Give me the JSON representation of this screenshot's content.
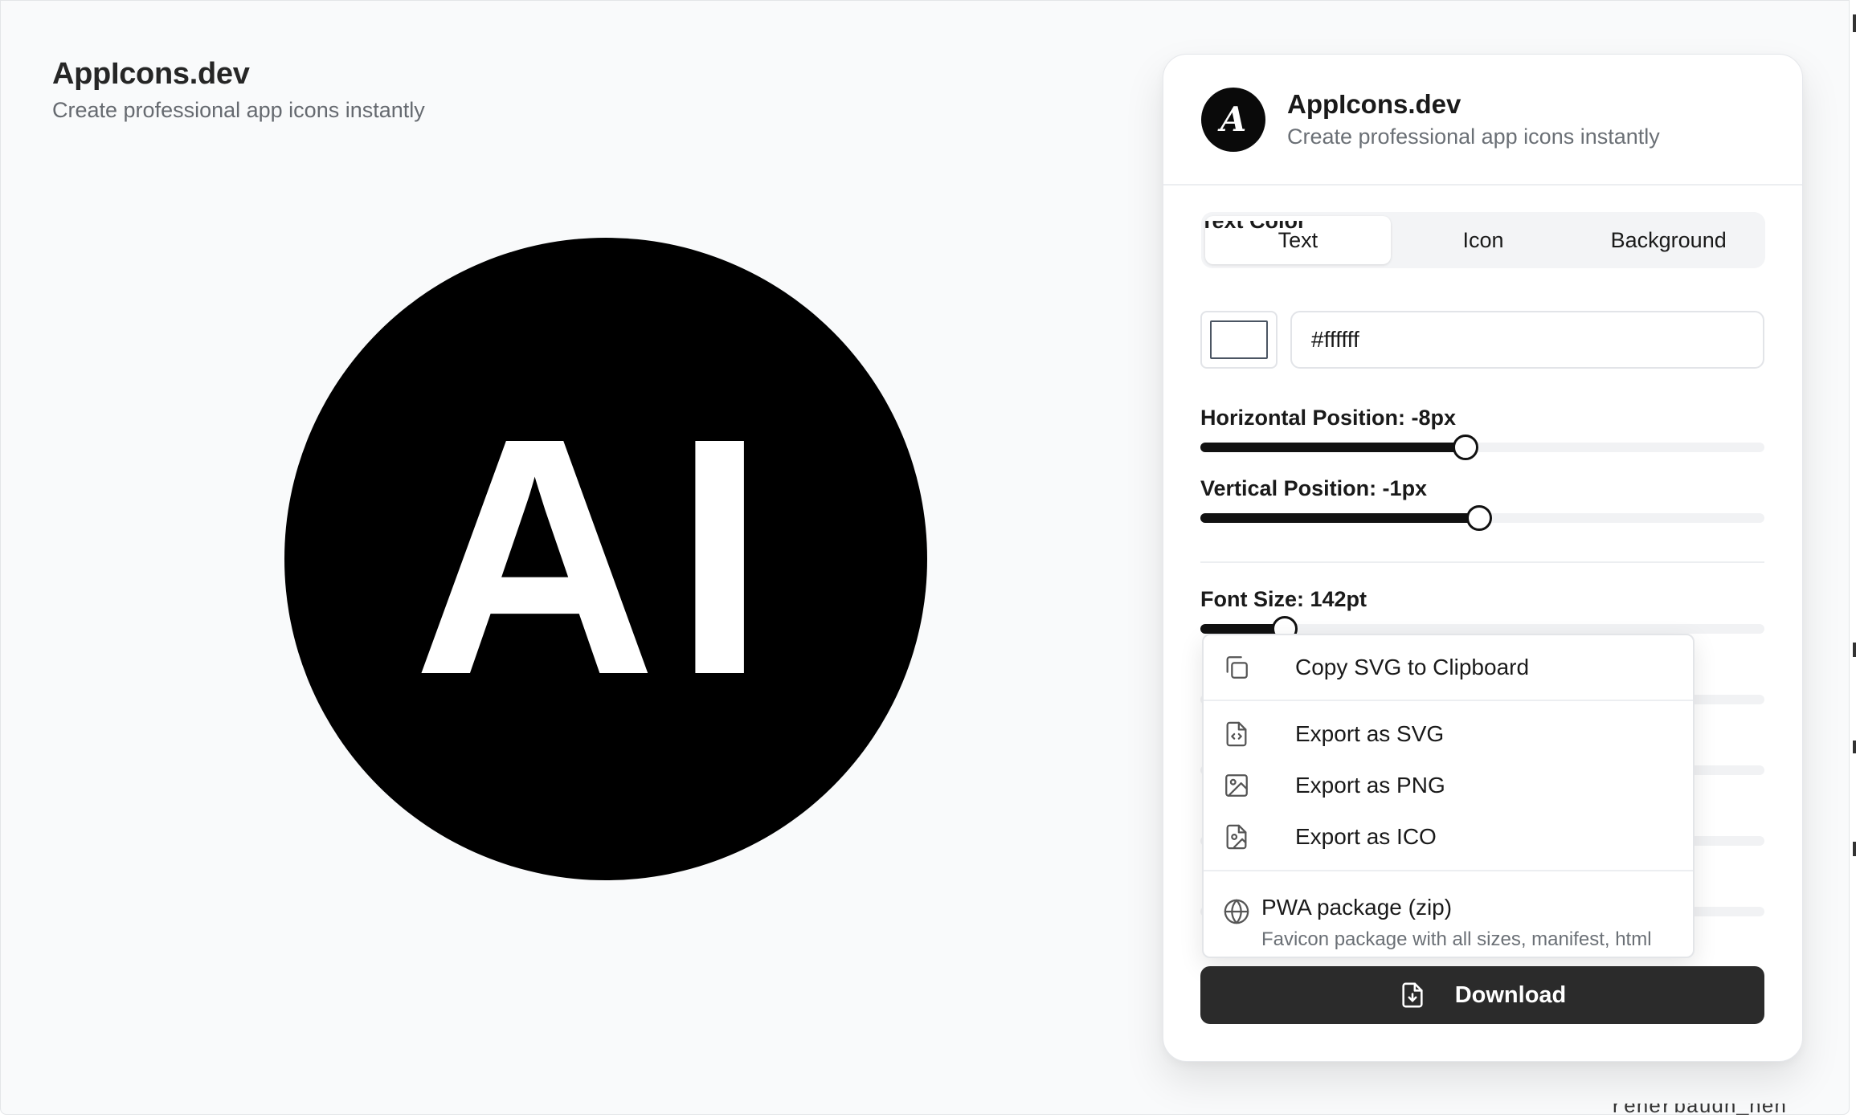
{
  "app": {
    "title": "AppIcons.dev",
    "subtitle": "Create professional app icons instantly"
  },
  "preview": {
    "text": "AI",
    "text_color": "#ffffff",
    "background_color": "#000000",
    "shape": "circle"
  },
  "panel": {
    "logo_letter": "A",
    "title": "AppIcons.dev",
    "subtitle": "Create professional app icons instantly",
    "tabs": [
      {
        "label": "Text",
        "active": true
      },
      {
        "label": "Icon",
        "active": false
      },
      {
        "label": "Background",
        "active": false
      }
    ],
    "text_color": {
      "label": "Text Color",
      "value": "#ffffff"
    },
    "horizontal_position": {
      "label": "Horizontal Position: -8px",
      "fill_fraction": 0.47
    },
    "vertical_position": {
      "label": "Vertical Position: -1px",
      "fill_fraction": 0.495
    },
    "font_size": {
      "label": "Font Size: 142pt",
      "fill_fraction": 0.15
    }
  },
  "export_menu": {
    "items": [
      {
        "label": "Copy SVG to Clipboard",
        "icon": "copy-icon"
      },
      {
        "label": "Export as SVG",
        "icon": "file-code-icon"
      },
      {
        "label": "Export as PNG",
        "icon": "image-icon"
      },
      {
        "label": "Export as ICO",
        "icon": "file-image-icon"
      }
    ],
    "pwa": {
      "title": "PWA package (zip)",
      "description": "Favicon package with all sizes, manifest, html",
      "icon": "globe-icon"
    }
  },
  "download": {
    "label": "Download",
    "icon": "file-download-icon"
  },
  "edge_fragment": "renerbaudh_nen",
  "colors": {
    "accent": "#111111",
    "button": "#2b2b2b",
    "page_bg": "#f9fafb"
  }
}
